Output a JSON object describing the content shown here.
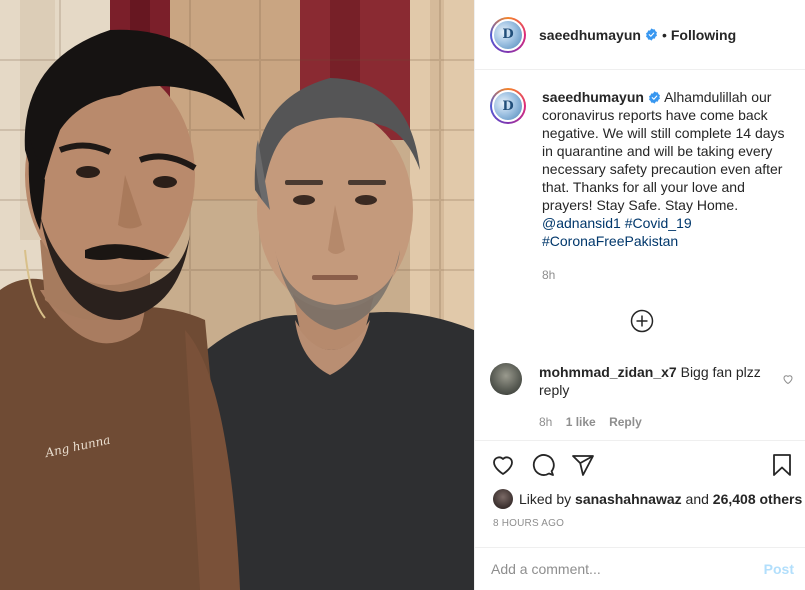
{
  "header": {
    "username": "saeedhumayun",
    "separator": "•",
    "follow_status": "Following",
    "avatar_letter": "D"
  },
  "caption": {
    "username": "saeedhumayun",
    "text": "Alhamdulillah our coronavirus reports have come back negative. We will still complete 14 days in quarantine and will be taking every necessary safety precaution even after that. Thanks for all your love and prayers! Stay Safe. Stay Home.",
    "mention": "@adnansid1",
    "hashtags": [
      "#Covid_19",
      "#CoronaFreePakistan"
    ],
    "timestamp": "8h"
  },
  "comments": [
    {
      "username": "mohmmad_zidan_x7",
      "text": "Bigg fan plzz reply",
      "time": "8h",
      "likes": "1 like",
      "reply_label": "Reply"
    }
  ],
  "actions": {
    "like_icon": "heart-icon",
    "comment_icon": "comment-icon",
    "share_icon": "paper-plane-icon",
    "save_icon": "bookmark-icon"
  },
  "likes": {
    "prefix": "Liked by",
    "user": "sanashahnawaz",
    "and": "and",
    "others": "26,408 others"
  },
  "posted_ago": "8 HOURS AGO",
  "add_comment": {
    "placeholder": "Add a comment...",
    "post_label": "Post"
  },
  "photo": {
    "shirt_text": "Ang hunna"
  },
  "colors": {
    "link": "#00376b",
    "muted": "#8e8e8e",
    "post_disabled": "#b2dffc",
    "verified": "#3897f0"
  }
}
